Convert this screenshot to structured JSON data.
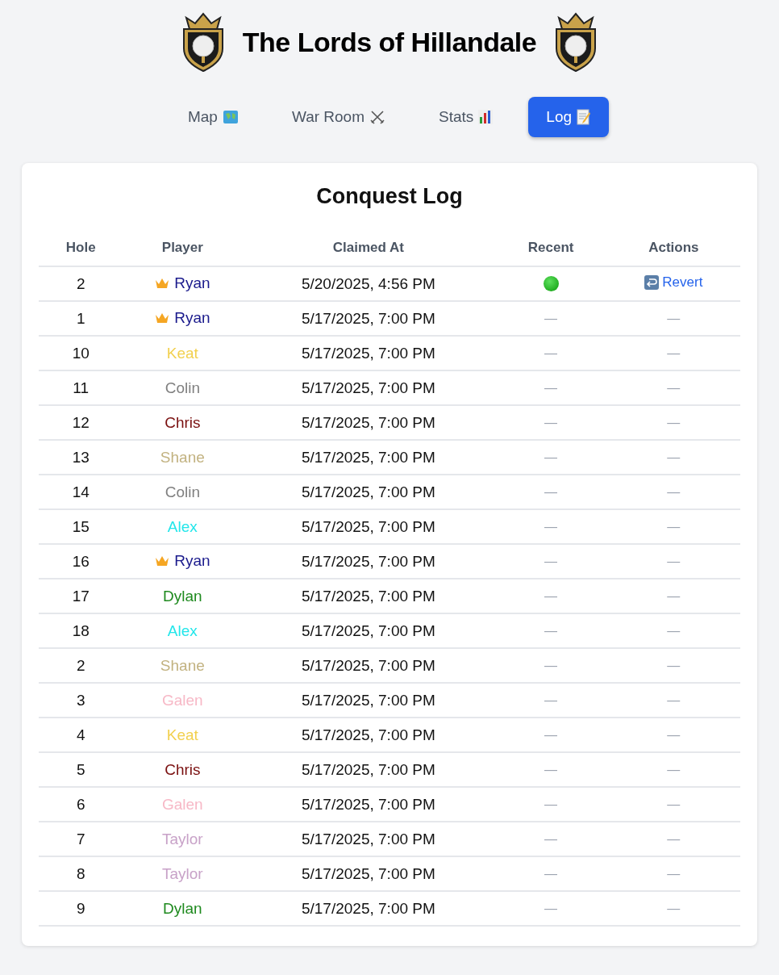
{
  "header": {
    "title": "The Lords of Hillandale"
  },
  "nav": [
    {
      "label": "Map",
      "kind": "map",
      "selected": false
    },
    {
      "label": "War Room",
      "kind": "swords",
      "selected": false
    },
    {
      "label": "Stats",
      "kind": "chart",
      "selected": false
    },
    {
      "label": "Log",
      "kind": "memo",
      "selected": true
    }
  ],
  "log": {
    "title": "Conquest Log",
    "columns": [
      "Hole",
      "Player",
      "Claimed At",
      "Recent",
      "Actions"
    ],
    "rows": [
      {
        "hole": "2",
        "player": "Ryan",
        "crowned": true,
        "color": "#1a1a8c",
        "claimed_at": "5/20/2025, 4:56 PM",
        "recent": {
          "kind": "dot"
        },
        "action": {
          "kind": "revert",
          "label": "Revert"
        }
      },
      {
        "hole": "1",
        "player": "Ryan",
        "crowned": true,
        "color": "#1a1a8c",
        "claimed_at": "5/17/2025, 7:00 PM",
        "recent": {
          "kind": "none",
          "label": "—"
        },
        "action": {
          "kind": "none",
          "label": "—"
        }
      },
      {
        "hole": "10",
        "player": "Keat",
        "crowned": false,
        "color": "#f2d04e",
        "claimed_at": "5/17/2025, 7:00 PM",
        "recent": {
          "kind": "none",
          "label": "—"
        },
        "action": {
          "kind": "none",
          "label": "—"
        }
      },
      {
        "hole": "11",
        "player": "Colin",
        "crowned": false,
        "color": "#808080",
        "claimed_at": "5/17/2025, 7:00 PM",
        "recent": {
          "kind": "none",
          "label": "—"
        },
        "action": {
          "kind": "none",
          "label": "—"
        }
      },
      {
        "hole": "12",
        "player": "Chris",
        "crowned": false,
        "color": "#7a1010",
        "claimed_at": "5/17/2025, 7:00 PM",
        "recent": {
          "kind": "none",
          "label": "—"
        },
        "action": {
          "kind": "none",
          "label": "—"
        }
      },
      {
        "hole": "13",
        "player": "Shane",
        "crowned": false,
        "color": "#c2b280",
        "claimed_at": "5/17/2025, 7:00 PM",
        "recent": {
          "kind": "none",
          "label": "—"
        },
        "action": {
          "kind": "none",
          "label": "—"
        }
      },
      {
        "hole": "14",
        "player": "Colin",
        "crowned": false,
        "color": "#808080",
        "claimed_at": "5/17/2025, 7:00 PM",
        "recent": {
          "kind": "none",
          "label": "—"
        },
        "action": {
          "kind": "none",
          "label": "—"
        }
      },
      {
        "hole": "15",
        "player": "Alex",
        "crowned": false,
        "color": "#22e6ea",
        "claimed_at": "5/17/2025, 7:00 PM",
        "recent": {
          "kind": "none",
          "label": "—"
        },
        "action": {
          "kind": "none",
          "label": "—"
        }
      },
      {
        "hole": "16",
        "player": "Ryan",
        "crowned": true,
        "color": "#1a1a8c",
        "claimed_at": "5/17/2025, 7:00 PM",
        "recent": {
          "kind": "none",
          "label": "—"
        },
        "action": {
          "kind": "none",
          "label": "—"
        }
      },
      {
        "hole": "17",
        "player": "Dylan",
        "crowned": false,
        "color": "#1f8a1f",
        "claimed_at": "5/17/2025, 7:00 PM",
        "recent": {
          "kind": "none",
          "label": "—"
        },
        "action": {
          "kind": "none",
          "label": "—"
        }
      },
      {
        "hole": "18",
        "player": "Alex",
        "crowned": false,
        "color": "#22e6ea",
        "claimed_at": "5/17/2025, 7:00 PM",
        "recent": {
          "kind": "none",
          "label": "—"
        },
        "action": {
          "kind": "none",
          "label": "—"
        }
      },
      {
        "hole": "2",
        "player": "Shane",
        "crowned": false,
        "color": "#c2b280",
        "claimed_at": "5/17/2025, 7:00 PM",
        "recent": {
          "kind": "none",
          "label": "—"
        },
        "action": {
          "kind": "none",
          "label": "—"
        }
      },
      {
        "hole": "3",
        "player": "Galen",
        "crowned": false,
        "color": "#f7b8c6",
        "claimed_at": "5/17/2025, 7:00 PM",
        "recent": {
          "kind": "none",
          "label": "—"
        },
        "action": {
          "kind": "none",
          "label": "—"
        }
      },
      {
        "hole": "4",
        "player": "Keat",
        "crowned": false,
        "color": "#f2d04e",
        "claimed_at": "5/17/2025, 7:00 PM",
        "recent": {
          "kind": "none",
          "label": "—"
        },
        "action": {
          "kind": "none",
          "label": "—"
        }
      },
      {
        "hole": "5",
        "player": "Chris",
        "crowned": false,
        "color": "#7a1010",
        "claimed_at": "5/17/2025, 7:00 PM",
        "recent": {
          "kind": "none",
          "label": "—"
        },
        "action": {
          "kind": "none",
          "label": "—"
        }
      },
      {
        "hole": "6",
        "player": "Galen",
        "crowned": false,
        "color": "#f7b8c6",
        "claimed_at": "5/17/2025, 7:00 PM",
        "recent": {
          "kind": "none",
          "label": "—"
        },
        "action": {
          "kind": "none",
          "label": "—"
        }
      },
      {
        "hole": "7",
        "player": "Taylor",
        "crowned": false,
        "color": "#c8a2c8",
        "claimed_at": "5/17/2025, 7:00 PM",
        "recent": {
          "kind": "none",
          "label": "—"
        },
        "action": {
          "kind": "none",
          "label": "—"
        }
      },
      {
        "hole": "8",
        "player": "Taylor",
        "crowned": false,
        "color": "#c8a2c8",
        "claimed_at": "5/17/2025, 7:00 PM",
        "recent": {
          "kind": "none",
          "label": "—"
        },
        "action": {
          "kind": "none",
          "label": "—"
        }
      },
      {
        "hole": "9",
        "player": "Dylan",
        "crowned": false,
        "color": "#1f8a1f",
        "claimed_at": "5/17/2025, 7:00 PM",
        "recent": {
          "kind": "none",
          "label": "—"
        },
        "action": {
          "kind": "none",
          "label": "—"
        }
      }
    ]
  }
}
